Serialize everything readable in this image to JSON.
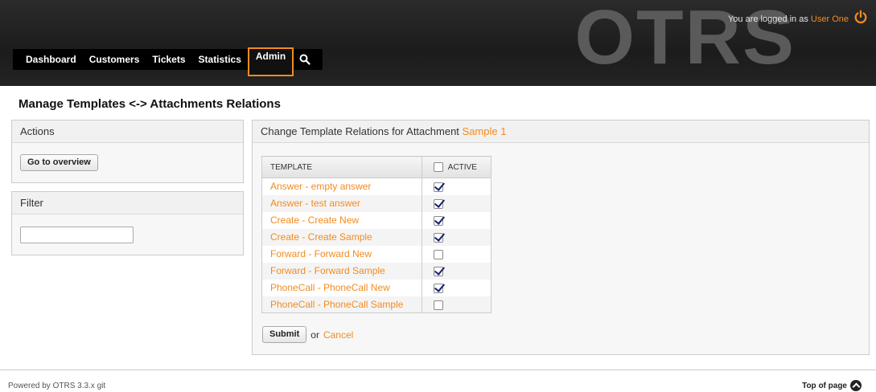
{
  "header": {
    "logo_text": "OTRS",
    "logged_in_prefix": "You are logged in as",
    "user_name": "User One"
  },
  "nav": {
    "items": [
      "Dashboard",
      "Customers",
      "Tickets",
      "Statistics",
      "Admin"
    ],
    "active": "Admin"
  },
  "page_title": "Manage Templates <-> Attachments Relations",
  "sidebar": {
    "actions_title": "Actions",
    "overview_button": "Go to overview",
    "filter_title": "Filter",
    "filter_value": ""
  },
  "main": {
    "heading_prefix": "Change Template Relations for Attachment",
    "attachment_name": "Sample 1",
    "col_template": "TEMPLATE",
    "col_active": "ACTIVE",
    "active_all_checked": false,
    "rows": [
      {
        "name": "Answer - empty answer",
        "active": true
      },
      {
        "name": "Answer - test answer",
        "active": true
      },
      {
        "name": "Create - Create New",
        "active": true
      },
      {
        "name": "Create - Create Sample",
        "active": true
      },
      {
        "name": "Forward - Forward New",
        "active": false
      },
      {
        "name": "Forward - Forward Sample",
        "active": true
      },
      {
        "name": "PhoneCall - PhoneCall New",
        "active": true
      },
      {
        "name": "PhoneCall - PhoneCall Sample",
        "active": false
      }
    ],
    "submit_label": "Submit",
    "or_text": "or",
    "cancel_label": "Cancel"
  },
  "footer": {
    "powered_by": "Powered by OTRS 3.3.x git",
    "top_of_page": "Top of page"
  },
  "colors": {
    "accent": "#f38b1f",
    "header_bg": "#222222"
  }
}
